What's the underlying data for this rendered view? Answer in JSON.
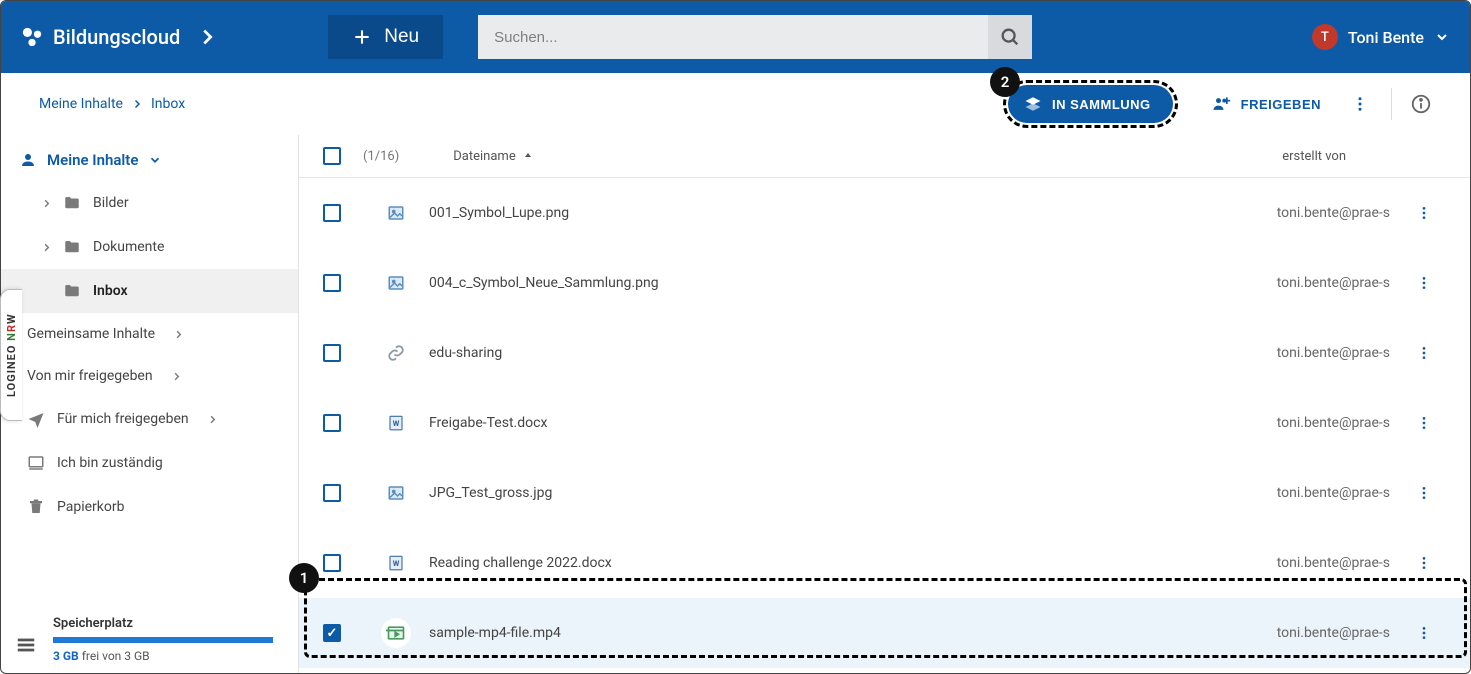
{
  "header": {
    "brand": "Bildungscloud",
    "new_label": "Neu",
    "search_placeholder": "Suchen...",
    "user_name": "Toni Bente",
    "user_initial": "T"
  },
  "subbar": {
    "crumbs": [
      "Meine Inhalte",
      "Inbox"
    ],
    "in_sammlung": "IN SAMMLUNG",
    "freigeben": "FREIGEBEN"
  },
  "callouts": {
    "in_sammlung": "2",
    "selected_row": "1"
  },
  "sidebar": {
    "header": "Meine Inhalte",
    "tree": [
      {
        "label": "Bilder",
        "icon": "folder",
        "level": 1,
        "expandable": true
      },
      {
        "label": "Dokumente",
        "icon": "folder",
        "level": 1,
        "expandable": true
      },
      {
        "label": "Inbox",
        "icon": "folder",
        "level": 1,
        "expandable": false,
        "active": true
      },
      {
        "label": "Gemeinsame Inhalte",
        "icon": "none",
        "level": 0,
        "expandable": true,
        "chev": "right"
      },
      {
        "label": "Von mir freigegeben",
        "icon": "none",
        "level": 0,
        "expandable": true,
        "chev": "right"
      },
      {
        "label": "Für mich freigegeben",
        "icon": "send",
        "level": 0,
        "expandable": true,
        "chev": "right"
      },
      {
        "label": "Ich bin zuständig",
        "icon": "monitor",
        "level": 0,
        "expandable": false
      },
      {
        "label": "Papierkorb",
        "icon": "trash",
        "level": 0,
        "expandable": false
      }
    ],
    "storage": {
      "title": "Speicherplatz",
      "used_label": "3 GB",
      "free_text": "frei von 3 GB"
    },
    "logineo": "LOGINEO"
  },
  "list": {
    "count": "(1/16)",
    "col_name": "Dateiname",
    "col_created": "erstellt von",
    "rows": [
      {
        "name": "001_Symbol_Lupe.png",
        "type": "image",
        "creator": "toni.bente@prae-s",
        "selected": false
      },
      {
        "name": "004_c_Symbol_Neue_Sammlung.png",
        "type": "image",
        "creator": "toni.bente@prae-s",
        "selected": false
      },
      {
        "name": "edu-sharing",
        "type": "link",
        "creator": "toni.bente@prae-s",
        "selected": false
      },
      {
        "name": "Freigabe-Test.docx",
        "type": "word",
        "creator": "toni.bente@prae-s",
        "selected": false
      },
      {
        "name": "JPG_Test_gross.jpg",
        "type": "image",
        "creator": "toni.bente@prae-s",
        "selected": false
      },
      {
        "name": "Reading challenge 2022.docx",
        "type": "word",
        "creator": "toni.bente@prae-s",
        "selected": false
      },
      {
        "name": "sample-mp4-file.mp4",
        "type": "video",
        "creator": "toni.bente@prae-s",
        "selected": true
      }
    ]
  }
}
